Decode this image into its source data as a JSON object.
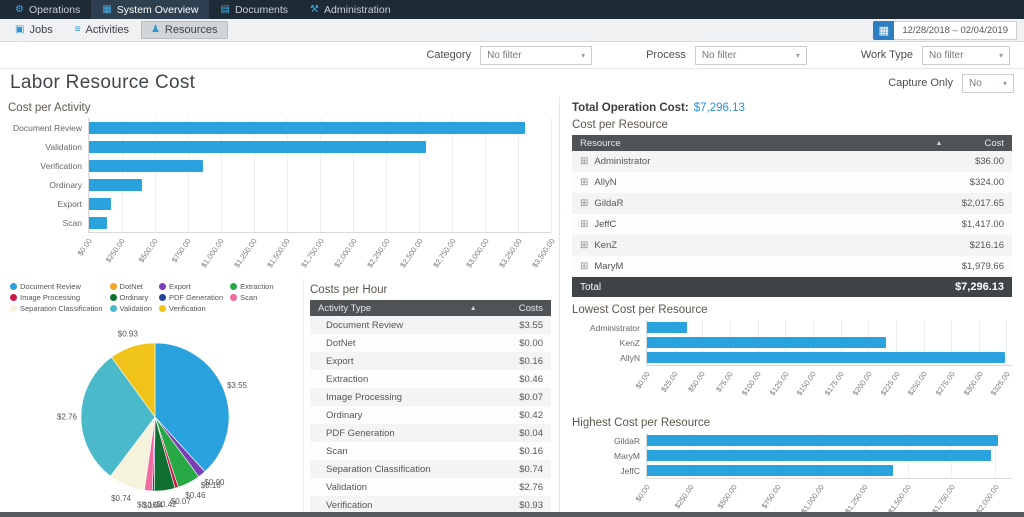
{
  "ui": {
    "dropdown_arrow": "▾",
    "sort_icon": "▲",
    "expand_icon": "⊞",
    "calendar_icon": "▦"
  },
  "colors": {
    "bar_blue": "#2aa2dd",
    "accent_blue": "#2d8fd8"
  },
  "top_nav": {
    "items": [
      {
        "label": "Operations",
        "glyph": "⚙",
        "active": false
      },
      {
        "label": "System Overview",
        "glyph": "▦",
        "active": true
      },
      {
        "label": "Documents",
        "glyph": "▤",
        "active": false
      },
      {
        "label": "Administration",
        "glyph": "⚒",
        "active": false
      }
    ]
  },
  "toolbar": {
    "items": [
      {
        "label": "Jobs",
        "glyph": "▣",
        "active": false
      },
      {
        "label": "Activities",
        "glyph": "≡",
        "active": false
      },
      {
        "label": "Resources",
        "glyph": "♟",
        "active": true
      }
    ],
    "date_range": "12/28/2018 – 02/04/2019"
  },
  "filters": [
    {
      "label": "Category",
      "value": "No filter"
    },
    {
      "label": "Process",
      "value": "No filter"
    },
    {
      "label": "Work Type",
      "value": "No filter"
    }
  ],
  "page": {
    "title": "Labor Resource Cost",
    "capture_only_label": "Capture Only",
    "capture_only_value": "No"
  },
  "summary": {
    "total_operation_cost_label": "Total Operation Cost:",
    "total_operation_cost_value": "$7,296.13"
  },
  "tables": {
    "costs_per_hour": {
      "title": "Costs per Hour",
      "headers": [
        "Activity Type",
        "Costs"
      ],
      "rows": [
        [
          "Document Review",
          "$3.55"
        ],
        [
          "DotNet",
          "$0.00"
        ],
        [
          "Export",
          "$0.16"
        ],
        [
          "Extraction",
          "$0.46"
        ],
        [
          "Image Processing",
          "$0.07"
        ],
        [
          "Ordinary",
          "$0.42"
        ],
        [
          "PDF Generation",
          "$0.04"
        ],
        [
          "Scan",
          "$0.16"
        ],
        [
          "Separation Classification",
          "$0.74"
        ],
        [
          "Validation",
          "$2.76"
        ],
        [
          "Verification",
          "$0.93"
        ]
      ]
    },
    "cost_per_resource": {
      "title": "Cost per Resource",
      "headers": [
        "Resource",
        "Cost"
      ],
      "expandable": true,
      "rows": [
        [
          "Administrator",
          "$36.00"
        ],
        [
          "AllyN",
          "$324.00"
        ],
        [
          "GildaR",
          "$2,017.65"
        ],
        [
          "JeffC",
          "$1,417.00"
        ],
        [
          "KenZ",
          "$216.16"
        ],
        [
          "MaryM",
          "$1,979.66"
        ]
      ],
      "total_label": "Total",
      "total_value": "$7,296.13"
    }
  },
  "chart_data": [
    {
      "id": "cost_per_activity",
      "type": "bar",
      "orientation": "horizontal",
      "title": "Cost per Activity",
      "categories": [
        "Document Review",
        "Validation",
        "Verification",
        "Ordinary",
        "Export",
        "Scan"
      ],
      "values": [
        3300,
        2550,
        860,
        400,
        170,
        140
      ],
      "xmax": 3500,
      "tick_values": [
        0,
        250,
        500,
        750,
        1000,
        1250,
        1500,
        1750,
        2000,
        2250,
        2500,
        2750,
        3000,
        3250,
        3500
      ],
      "ticks": [
        "$0.00",
        "$250.00",
        "$500.00",
        "$750.00",
        "$1,000.00",
        "$1,250.00",
        "$1,500.00",
        "$1,750.00",
        "$2,000.00",
        "$2,250.00",
        "$2,500.00",
        "$2,750.00",
        "$3,000.00",
        "$3,250.00",
        "$3,500.00"
      ],
      "bar_color": "#2aa2dd",
      "grid": true,
      "legend": false
    },
    {
      "id": "costs_per_hour_pie",
      "type": "pie",
      "title": "Costs per Hour",
      "categories": [
        "Document Review",
        "DotNet",
        "Export",
        "Extraction",
        "Image Processing",
        "Ordinary",
        "PDF Generation",
        "Scan",
        "Separation Classification",
        "Validation",
        "Verification"
      ],
      "values": [
        3.55,
        0.0,
        0.16,
        0.46,
        0.07,
        0.42,
        0.04,
        0.16,
        0.74,
        2.76,
        0.93
      ],
      "labels": [
        "$3.55",
        "$0.00",
        "$0.16",
        "$0.46",
        "$0.07",
        "$0.42",
        "$0.04",
        "$0.16",
        "$0.74",
        "$2.76",
        "$0.93"
      ],
      "colors": [
        "#2aa2dd",
        "#f5a623",
        "#7b3fb5",
        "#27a844",
        "#c9184a",
        "#0e6f31",
        "#24419e",
        "#ef6a9e",
        "#f6f3dc",
        "#4ab9c9",
        "#efc31a"
      ],
      "legend_position": "top"
    },
    {
      "id": "lowest_cost_per_resource",
      "type": "bar",
      "orientation": "horizontal",
      "title": "Lowest Cost per Resource",
      "categories": [
        "Administrator",
        "KenZ",
        "AllyN"
      ],
      "values": [
        36.0,
        216.16,
        324.0
      ],
      "xmax": 330,
      "tick_values": [
        0,
        25,
        50,
        75,
        100,
        125,
        150,
        175,
        200,
        225,
        250,
        275,
        300,
        325
      ],
      "ticks": [
        "$0.00",
        "$25.00",
        "$50.00",
        "$75.00",
        "$100.00",
        "$125.00",
        "$150.00",
        "$175.00",
        "$200.00",
        "$225.00",
        "$250.00",
        "$275.00",
        "$300.00",
        "$325.00"
      ],
      "bar_color": "#2aa2dd",
      "grid": true,
      "legend": false
    },
    {
      "id": "highest_cost_per_resource",
      "type": "bar",
      "orientation": "horizontal",
      "title": "Highest Cost per Resource",
      "categories": [
        "GildaR",
        "MaryM",
        "JeffC"
      ],
      "values": [
        2017.65,
        1979.66,
        1417.0
      ],
      "xmax": 2100,
      "tick_values": [
        0,
        250,
        500,
        750,
        1000,
        1250,
        1500,
        1750,
        2000
      ],
      "ticks": [
        "$0.00",
        "$250.00",
        "$500.00",
        "$750.00",
        "$1,000.00",
        "$1,250.00",
        "$1,500.00",
        "$1,750.00",
        "$2,000.00"
      ],
      "bar_color": "#2aa2dd",
      "grid": true,
      "legend": false
    }
  ]
}
